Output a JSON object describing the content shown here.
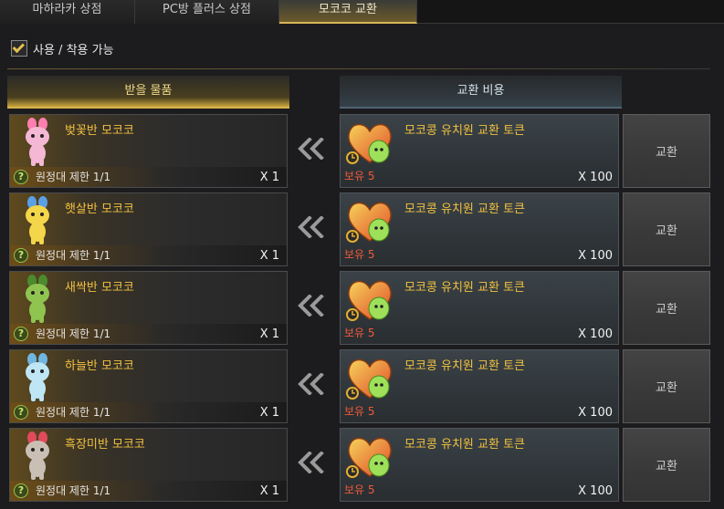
{
  "tabs": [
    {
      "label": "마하라카 상점",
      "active": false
    },
    {
      "label": "PC방 플러스 상점",
      "active": false
    },
    {
      "label": "모코코 교환",
      "active": true
    }
  ],
  "filter": {
    "label": "사용 / 착용 가능",
    "checked": true
  },
  "headers": {
    "receive": "받을 물품",
    "cost": "교환 비용"
  },
  "items": [
    {
      "name": "벚꽃반 모코코",
      "limit": "원정대 제한 1/1",
      "qty": "X 1",
      "body_color": "#f4b8d4",
      "accent": "#ff7fb0",
      "cost_name": "모코콩 유치원 교환 토큰",
      "owned": "보유 5",
      "cost_qty": "X 100",
      "button": "교환"
    },
    {
      "name": "햇살반 모코코",
      "limit": "원정대 제한 1/1",
      "qty": "X 1",
      "body_color": "#f4d64a",
      "accent": "#5aa0e6",
      "cost_name": "모코콩 유치원 교환 토큰",
      "owned": "보유 5",
      "cost_qty": "X 100",
      "button": "교환"
    },
    {
      "name": "새싹반 모코코",
      "limit": "원정대 제한 1/1",
      "qty": "X 1",
      "body_color": "#8fc450",
      "accent": "#4c8a2e",
      "cost_name": "모코콩 유치원 교환 토큰",
      "owned": "보유 5",
      "cost_qty": "X 100",
      "button": "교환"
    },
    {
      "name": "하늘반 모코코",
      "limit": "원정대 제한 1/1",
      "qty": "X 1",
      "body_color": "#bfe6f4",
      "accent": "#6fb6e0",
      "cost_name": "모코콩 유치원 교환 토큰",
      "owned": "보유 5",
      "cost_qty": "X 100",
      "button": "교환"
    },
    {
      "name": "흑장미반 모코코",
      "limit": "원정대 제한 1/1",
      "qty": "X 1",
      "body_color": "#c9bfb4",
      "accent": "#e04a5a",
      "cost_name": "모코콩 유치원 교환 토큰",
      "owned": "보유 5",
      "cost_qty": "X 100",
      "button": "교환"
    }
  ],
  "icons": {
    "limit": "question-icon",
    "arrow": "double-chevron-left-icon",
    "token": "heart-token-icon",
    "timer": "stopwatch-icon"
  }
}
